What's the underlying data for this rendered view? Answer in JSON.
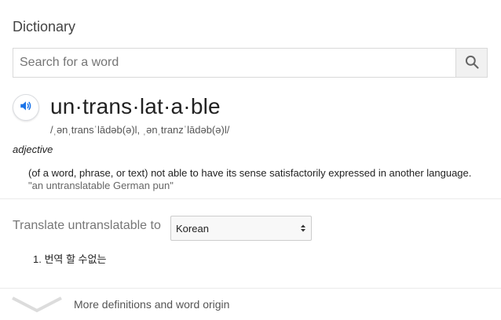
{
  "title": "Dictionary",
  "search": {
    "placeholder": "Search for a word",
    "value": "",
    "icon": "search-icon"
  },
  "entry": {
    "audio_icon": "speaker-icon",
    "headword": "un·trans·lat·a·ble",
    "phonetic": "/ˌənˌtransˈlādəb(ə)l, ˌənˌtranzˈlādəb(ə)l/",
    "part_of_speech": "adjective",
    "definition": "(of a word, phrase, or text) not able to have its sense satisfactorily expressed in another language.",
    "example": "\"an untranslatable German pun\""
  },
  "translate": {
    "label": "Translate untranslatable to",
    "selected_language": "Korean",
    "items": [
      "1. 번역 할 수없는"
    ]
  },
  "more": {
    "icon": "chevron-down-icon",
    "label": "More definitions and word origin"
  },
  "colors": {
    "accent": "#1a73e8",
    "text": "#222222",
    "muted": "#777777"
  }
}
